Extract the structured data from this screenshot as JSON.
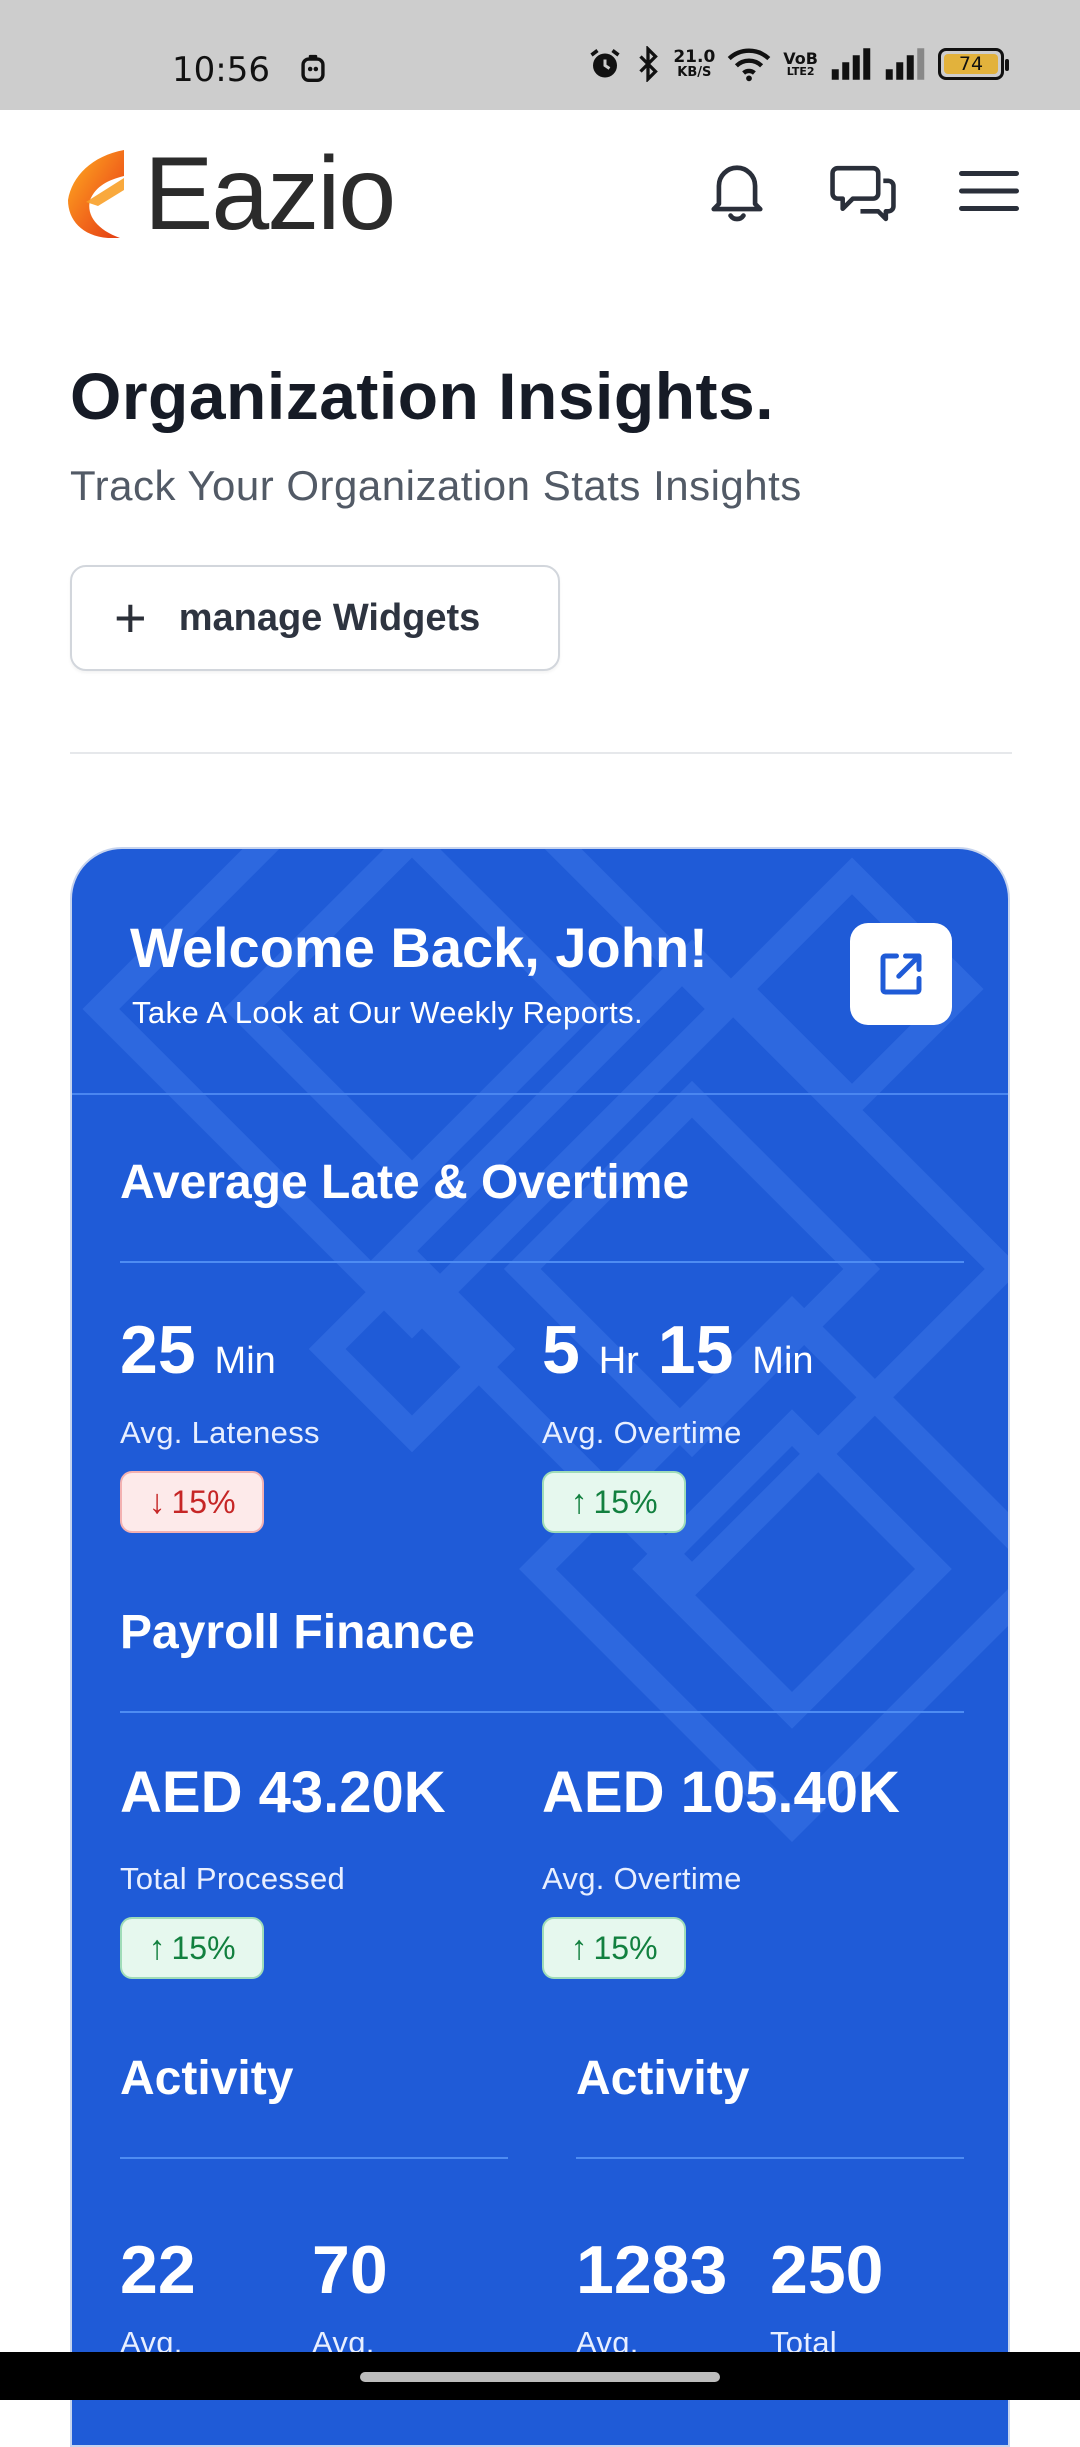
{
  "status_bar": {
    "time": "10:56",
    "speed_value": "21.0",
    "speed_unit": "KB/S",
    "volte_top": "VoB",
    "volte_bottom": "LTE2",
    "battery": "74"
  },
  "header": {
    "logo_text": "Eazio",
    "icons": [
      "bell-icon",
      "chat-icon",
      "menu-icon"
    ]
  },
  "page": {
    "title": "Organization Insights.",
    "subtitle": "Track Your Organization Stats Insights",
    "manage_button": "manage Widgets"
  },
  "card": {
    "welcome": "Welcome Back, John!",
    "welcome_sub": "Take A Look at Our Weekly Reports.",
    "late_overtime": {
      "title": "Average Late & Overtime",
      "lateness_value": "25",
      "lateness_unit": "Min",
      "lateness_label": "Avg. Lateness",
      "lateness_badge": "15%",
      "overtime_hr": "5",
      "overtime_hr_unit": "Hr",
      "overtime_min": "15",
      "overtime_min_unit": "Min",
      "overtime_label": "Avg. Overtime",
      "overtime_badge": "15%"
    },
    "payroll": {
      "title": "Payroll Finance",
      "processed_value": "AED 43.20K",
      "processed_label": "Total Processed",
      "processed_badge": "15%",
      "overtime_value": "AED 105.40K",
      "overtime_label": "Avg. Overtime",
      "overtime_badge": "15%"
    },
    "activity_left": {
      "title": "Activity",
      "v1": "22",
      "l1": "Avg.",
      "v2": "70",
      "l2": "Avg."
    },
    "activity_right": {
      "title": "Activity",
      "v1": "1283",
      "l1": "Avg.",
      "v2": "250",
      "l2": "Total"
    },
    "arrow_down": "↓",
    "arrow_up": "↑"
  },
  "colors": {
    "card_blue": "#1f5bd7",
    "badge_down": "#c62626",
    "badge_up": "#12803f"
  }
}
